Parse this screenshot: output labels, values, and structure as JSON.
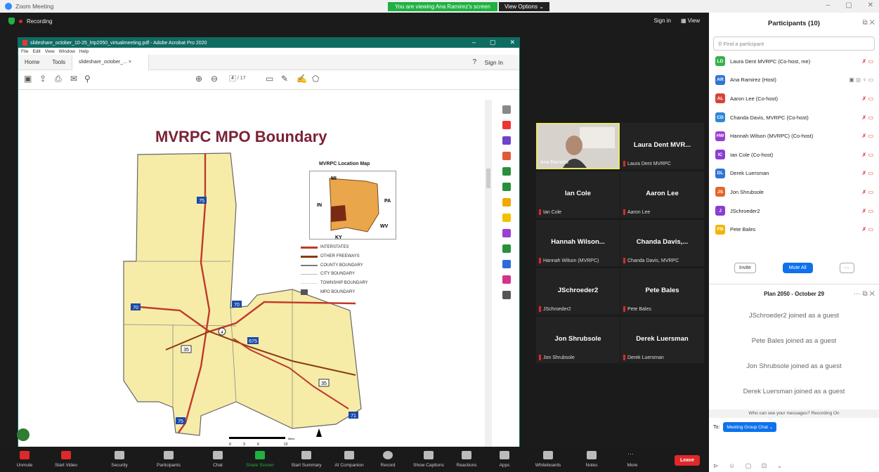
{
  "window": {
    "title": "Zoom Meeting",
    "min": "–",
    "max": "▢",
    "close": "✕"
  },
  "banner": {
    "viewing": "You are viewing Ana Ramirez's screen",
    "view_options": "View Options"
  },
  "recording": "Recording",
  "topbar": {
    "signin": "Sign in",
    "view": "View"
  },
  "acrobat": {
    "title": "slideshare_october_10-25_lrtp2050_virtualmeeting.pdf - Adobe Acrobat Pro 2020",
    "menu": [
      "File",
      "Edit",
      "View",
      "Window",
      "Help"
    ],
    "tabs": [
      "Home",
      "Tools",
      "slideshare_october_... ×"
    ],
    "signin": "Sign In",
    "page_current": "4",
    "page_total": "/ 17"
  },
  "slide": {
    "title": "MVRPC MPO Boundary",
    "locmap_title": "MVRPC Location Map",
    "locmap_labels": [
      "MI",
      "PA",
      "IN",
      "WV",
      "KY"
    ],
    "legend": [
      "INTERSTATES",
      "OTHER FREEWAYS",
      "COUNTY BOUNDARY",
      "CITY BOUNDARY",
      "TOWNSHIP BOUNDARY",
      "MPO BOUNDARY"
    ],
    "legend_colors": [
      "#c0392b",
      "#8b3a14",
      "#7a7a7a",
      "#bbbbbb",
      "#dddddd",
      "#555555"
    ],
    "shields": [
      "75",
      "70",
      "70",
      "675",
      "35",
      "35",
      "4",
      "75",
      "71"
    ],
    "scale": {
      "ticks": [
        "0",
        "3",
        "6",
        "",
        "12"
      ],
      "unit": "Miles"
    }
  },
  "videos": [
    {
      "name": "",
      "label": "Ana Ramirez",
      "self": true
    },
    {
      "name": "Laura Dent MVR...",
      "label": "Laura Dent MVRPC"
    },
    {
      "name": "Ian Cole",
      "label": "Ian Cole"
    },
    {
      "name": "Aaron Lee",
      "label": "Aaron Lee"
    },
    {
      "name": "Hannah Wilson...",
      "label": "Hannah Wilson (MVRPC)"
    },
    {
      "name": "Chanda Davis,...",
      "label": "Chanda Davis, MVRPC"
    },
    {
      "name": "JSchroeder2",
      "label": "JSchroeder2"
    },
    {
      "name": "Pete Bales",
      "label": "Pete Bales"
    },
    {
      "name": "Jon Shrubsole",
      "label": "Jon Shrubsole"
    },
    {
      "name": "Derek Luersman",
      "label": "Derek Luersman"
    }
  ],
  "participants": {
    "title": "Participants (10)",
    "search_placeholder": "Find a participant",
    "list": [
      {
        "initials": "LD",
        "name": "Laura Dent MVRPC (Co-host, me)",
        "color": "#36b24a"
      },
      {
        "initials": "AR",
        "name": "Ana Ramirez (Host)",
        "color": "#2e75d6"
      },
      {
        "initials": "AL",
        "name": "Aaron Lee (Co-host)",
        "color": "#d84336"
      },
      {
        "initials": "CD",
        "name": "Chanda Davis, MVRPC (Co-host)",
        "color": "#2e87d6"
      },
      {
        "initials": "HW",
        "name": "Hannah Wilson (MVRPC) (Co-host)",
        "color": "#9b3fd1"
      },
      {
        "initials": "IC",
        "name": "Ian Cole (Co-host)",
        "color": "#8a3ed3"
      },
      {
        "initials": "DL",
        "name": "Derek Luersman",
        "color": "#2e75d6"
      },
      {
        "initials": "JS",
        "name": "Jon Shrubsole",
        "color": "#e7642a"
      },
      {
        "initials": "J",
        "name": "JSchroeder2",
        "color": "#8a3ed3"
      },
      {
        "initials": "PB",
        "name": "Pete Bales",
        "color": "#f4b400"
      }
    ],
    "invite": "Invite",
    "mute_all": "Mute All",
    "more": "···"
  },
  "chat": {
    "title": "Plan 2050 - October 29",
    "messages": [
      "JSchroeder2 joined as a guest",
      "Pete Bales joined as a guest",
      "Jon Shrubsole joined as a guest",
      "Derek Luersman joined as a guest"
    ],
    "notice": "Who can see your messages? Recording On",
    "to_label": "To:",
    "to_value": "Meeting Group Chat"
  },
  "toolbar": [
    "Unmute",
    "Start Video",
    "Security",
    "Participants",
    "Chat",
    "Share Screen",
    "Start Summary",
    "AI Companion",
    "Record",
    "Show Captions",
    "Reactions",
    "Apps",
    "Whiteboards",
    "Notes",
    "More"
  ],
  "participants_count": "10",
  "leave": "Leave"
}
